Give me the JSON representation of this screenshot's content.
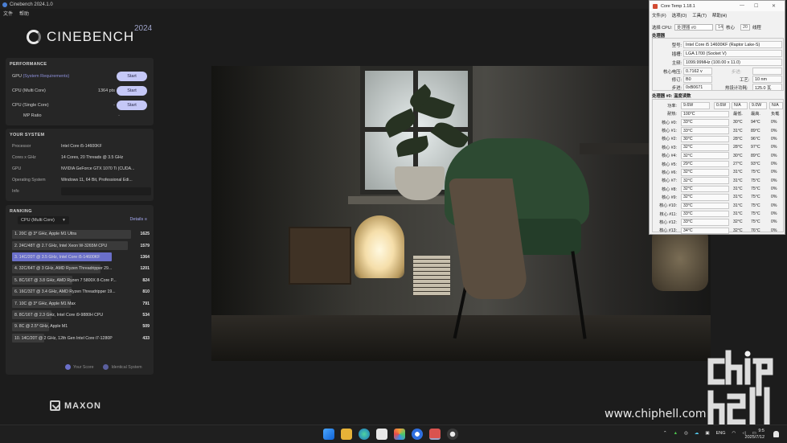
{
  "cinebench": {
    "window_title": "Cinebench 2024.1.0",
    "menu": [
      "文件",
      "帮助"
    ],
    "logo_text": "CINEBENCH",
    "year": "2024",
    "performance": {
      "title": "PERFORMANCE",
      "gpu_label": "GPU",
      "gpu_sub": "(System Requirements)",
      "multi_label": "CPU (Multi Core)",
      "multi_score": "1364 pts",
      "single_label": "CPU (Single Core)",
      "single_score": "-",
      "mp_label": "MP Ratio",
      "mp_value": "-",
      "start_label": "Start"
    },
    "system": {
      "title": "YOUR SYSTEM",
      "rows": [
        {
          "k": "Processor",
          "v": "Intel Core i5-14600KF"
        },
        {
          "k": "Cores x GHz",
          "v": "14 Cores, 20 Threads @ 3.5 GHz"
        },
        {
          "k": "GPU",
          "v": "NVIDIA GeForce GTX 1070 Ti (CUDA..."
        },
        {
          "k": "Operating System",
          "v": "Windows 11, 64 Bit, Professional Edi..."
        },
        {
          "k": "Info",
          "v": ""
        }
      ]
    },
    "ranking": {
      "title": "RANKING",
      "selector": "CPU (Multi Core)",
      "details_label": "Details",
      "items": [
        {
          "text": "1. 20C @ 3* GHz, Apple M1 Ultra",
          "score": "1625",
          "fill": 1.0
        },
        {
          "text": "2. 24C/48T @ 2.7 GHz, Intel Xeon W-3265M CPU",
          "score": "1579",
          "fill": 0.97
        },
        {
          "text": "3. 14C/20T @ 3.5 GHz, Intel Core i5-14600KF",
          "score": "1364",
          "fill": 0.84,
          "you": true
        },
        {
          "text": "4. 32C/64T @ 3 GHz, AMD Ryzen Threadripper 29...",
          "score": "1201",
          "fill": 0.74
        },
        {
          "text": "5. 8C/16T @ 3.8 GHz, AMD Ryzen 7 5800X 8-Core P...",
          "score": "824",
          "fill": 0.51
        },
        {
          "text": "6. 16C/32T @ 3.4 GHz, AMD Ryzen Threadripper 19...",
          "score": "810",
          "fill": 0.5
        },
        {
          "text": "7. 10C @ 3* GHz, Apple M1 Max",
          "score": "791",
          "fill": 0.49
        },
        {
          "text": "8. 8C/16T @ 2.3 GHz, Intel Core i9-9880H CPU",
          "score": "534",
          "fill": 0.33
        },
        {
          "text": "9. 8C @ 2.5* GHz, Apple M1",
          "score": "509",
          "fill": 0.31
        },
        {
          "text": "10. 14C/20T @ 2 GHz, 12th Gen Intel Core i7-1280P",
          "score": "433",
          "fill": 0.27
        }
      ],
      "legend_your": "Your Score",
      "legend_identical": "Identical System"
    },
    "maxon": "MAXON"
  },
  "coretemp": {
    "title": "Core Temp 1.18.1",
    "menu": [
      "文件(F)",
      "选项(O)",
      "工具(T)",
      "帮助(H)"
    ],
    "cpu_select_label": "选择 CPU:",
    "cpu_select_value": "处理器 #0",
    "cores_value": "14",
    "cores_label": "核心",
    "threads_value": "20",
    "threads_label": "线程",
    "proc_section": "处理器",
    "model_k": "型号:",
    "model_v": "Intel Core i5 14600KF (Raptor Lake-S)",
    "socket_k": "插槽:",
    "socket_v": "LGA 1700 (Socket V)",
    "freq_k": "主频:",
    "freq_v": "1099.99MHz (100.00 x 11.0)",
    "vid_k": "核心电压:",
    "vid_v": "0.7162 v",
    "step_k": "步进:",
    "step_v": "",
    "rev_k": "修订:",
    "rev_v": "B0",
    "lith_k": "工艺:",
    "lith_v": "10 nm",
    "cpuid_k": "步进:",
    "cpuid_v": "0xB0671",
    "tdp_k": "热设计功耗:",
    "tdp_v": "125.0 瓦",
    "temp_section": "处理器 #0: 温度读数",
    "power_k": "功率:",
    "power_vals": [
      "9.6W",
      "0.6W",
      "N/A",
      "9.0W",
      "N/A"
    ],
    "tj_k": "耐热:",
    "tj_v": "100°C",
    "hdr_min": "最低.",
    "hdr_max": "最高.",
    "hdr_load": "负载",
    "cores": [
      {
        "name": "核心 #0:",
        "temp": "33°C",
        "min": "30°C",
        "max": "94°C",
        "load": "0%"
      },
      {
        "name": "核心 #1:",
        "temp": "33°C",
        "min": "31°C",
        "max": "89°C",
        "load": "0%"
      },
      {
        "name": "核心 #2:",
        "temp": "30°C",
        "min": "28°C",
        "max": "96°C",
        "load": "0%"
      },
      {
        "name": "核心 #3:",
        "temp": "32°C",
        "min": "28°C",
        "max": "97°C",
        "load": "0%"
      },
      {
        "name": "核心 #4:",
        "temp": "32°C",
        "min": "30°C",
        "max": "89°C",
        "load": "0%"
      },
      {
        "name": "核心 #5:",
        "temp": "29°C",
        "min": "27°C",
        "max": "93°C",
        "load": "0%"
      },
      {
        "name": "核心 #6:",
        "temp": "32°C",
        "min": "31°C",
        "max": "75°C",
        "load": "0%"
      },
      {
        "name": "核心 #7:",
        "temp": "32°C",
        "min": "31°C",
        "max": "75°C",
        "load": "0%"
      },
      {
        "name": "核心 #8:",
        "temp": "32°C",
        "min": "31°C",
        "max": "75°C",
        "load": "0%"
      },
      {
        "name": "核心 #9:",
        "temp": "32°C",
        "min": "31°C",
        "max": "75°C",
        "load": "0%"
      },
      {
        "name": "核心 #10:",
        "temp": "33°C",
        "min": "31°C",
        "max": "75°C",
        "load": "0%"
      },
      {
        "name": "核心 #11:",
        "temp": "33°C",
        "min": "31°C",
        "max": "75°C",
        "load": "0%"
      },
      {
        "name": "核心 #12:",
        "temp": "33°C",
        "min": "32°C",
        "max": "75°C",
        "load": "0%"
      },
      {
        "name": "核心 #13:",
        "temp": "34°C",
        "min": "32°C",
        "max": "76°C",
        "load": "0%"
      }
    ]
  },
  "taskbar": {
    "lang": "ENG",
    "time": "9:5",
    "date": "2025/7/12"
  },
  "watermark": {
    "url": "www.chiphell.com",
    "logo_text": "chip hell"
  },
  "colors": {
    "accent": "#c5c8f7",
    "your_score": "#6a6fc9",
    "identical": "#5a5f9e"
  }
}
